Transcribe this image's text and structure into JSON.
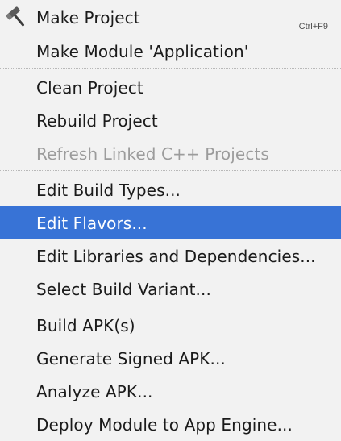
{
  "menu": {
    "items": [
      {
        "label": "Make Project",
        "shortcut": "Ctrl+F9",
        "icon": "hammer-icon"
      },
      {
        "label": "Make Module 'Application'"
      },
      {
        "label": "Clean Project"
      },
      {
        "label": "Rebuild Project"
      },
      {
        "label": "Refresh Linked C++ Projects",
        "disabled": true
      },
      {
        "label": "Edit Build Types..."
      },
      {
        "label": "Edit Flavors...",
        "selected": true
      },
      {
        "label": "Edit Libraries and Dependencies..."
      },
      {
        "label": "Select Build Variant..."
      },
      {
        "label": "Build APK(s)"
      },
      {
        "label": "Generate Signed APK..."
      },
      {
        "label": "Analyze APK..."
      },
      {
        "label": "Deploy Module to App Engine..."
      }
    ]
  },
  "colors": {
    "background": "#f2f2f2",
    "selection": "#3873d6",
    "text": "#1b1b1b",
    "disabled_text": "#9c9c9c",
    "separator": "#b8b8b8"
  }
}
